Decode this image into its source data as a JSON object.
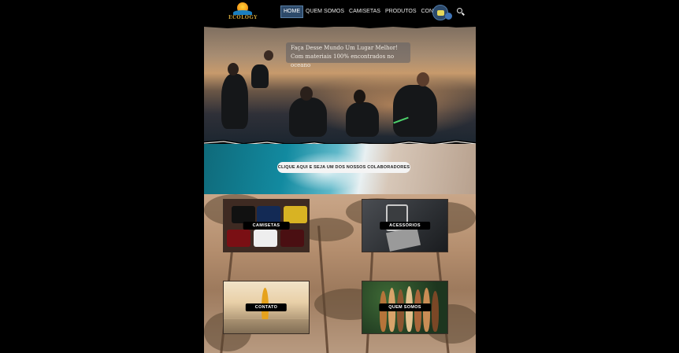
{
  "header": {
    "logo_text": "ECOLOGY",
    "nav": [
      {
        "label": "HOME",
        "active": true
      },
      {
        "label": "QUEM SOMOS",
        "active": false
      },
      {
        "label": "CAMISETAS",
        "active": false
      },
      {
        "label": "PRODUTOS",
        "active": false
      },
      {
        "label": "CONTATO",
        "active": false
      }
    ],
    "search_icon": "search-icon",
    "chat_icon": "chat-icon"
  },
  "hero": {
    "caption_line1": "Faça Desse Mundo Um Lugar Melhor!",
    "caption_line2": "Com materiais 100% encontrados no oceano"
  },
  "banner": {
    "cta_label": "CLIQUE AQUI E SEJA UM DOS NOSSOS COLABORADORES"
  },
  "cards": {
    "shirts": "CAMISETAS",
    "accessories": "ACESSÓRIOS",
    "contact": "CONTATO",
    "about": "QUEM SOMOS"
  },
  "colors": {
    "background": "#000000",
    "nav_active": "#2d4a6a",
    "card_label_bg": "#000000"
  }
}
